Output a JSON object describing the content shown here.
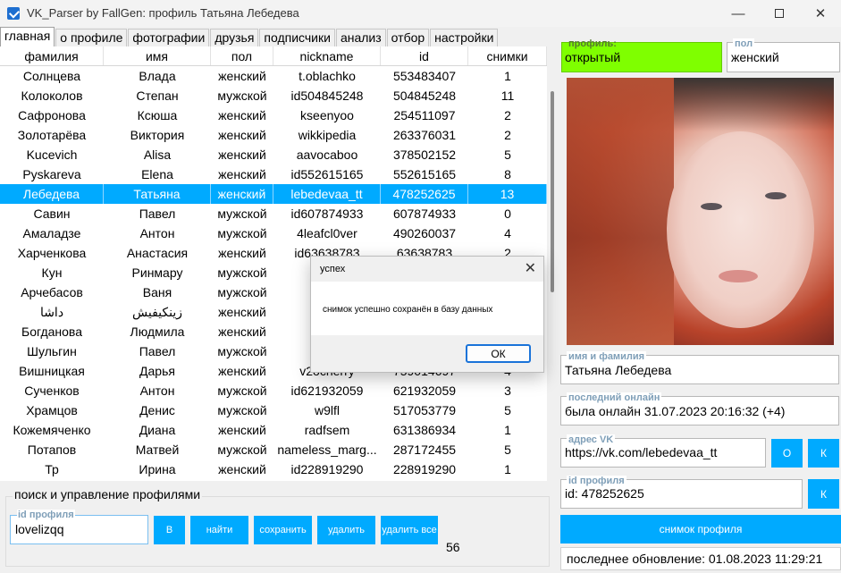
{
  "window": {
    "title": "VK_Parser by FallGen: профиль Татьяна Лебедева",
    "minimize": "—",
    "close": "✕"
  },
  "tabs": [
    "главная",
    "о профиле",
    "фотографии",
    "друзья",
    "подписчики",
    "анализ",
    "отбор",
    "настройки"
  ],
  "table": {
    "headers": [
      "фамилия",
      "имя",
      "пол",
      "nickname",
      "id",
      "снимки"
    ],
    "rows": [
      [
        "Солнцева",
        "Влада",
        "женский",
        "t.oblachko",
        "553483407",
        "1"
      ],
      [
        "Колоколов",
        "Степан",
        "мужской",
        "id504845248",
        "504845248",
        "11"
      ],
      [
        "Сафронова",
        "Ксюша",
        "женский",
        "kseenyoo",
        "254511097",
        "2"
      ],
      [
        "Золотарёва",
        "Виктория",
        "женский",
        "wikkipedia",
        "263376031",
        "2"
      ],
      [
        "Kucevich",
        "Alisa",
        "женский",
        "aavocaboo",
        "378502152",
        "5"
      ],
      [
        "Pyskareva",
        "Elena",
        "женский",
        "id552615165",
        "552615165",
        "8"
      ],
      [
        "Лебедева",
        "Татьяна",
        "женский",
        "lebedevaa_tt",
        "478252625",
        "13"
      ],
      [
        "Савин",
        "Павел",
        "мужской",
        "id607874933",
        "607874933",
        "0"
      ],
      [
        "Амаладзе",
        "Антон",
        "мужской",
        "4leafcl0ver",
        "490260037",
        "4"
      ],
      [
        "Харченкова",
        "Анастасия",
        "женский",
        "id63638783",
        "63638783",
        "2"
      ],
      [
        "Кун",
        "Ринмару",
        "мужской",
        "id70",
        "",
        ""
      ],
      [
        "Арчебасов",
        "Ваня",
        "мужской",
        "f",
        "",
        ""
      ],
      [
        "داشا",
        "زینکیفیش",
        "женский",
        "zir",
        "",
        ""
      ],
      [
        "Богданова",
        "Людмила",
        "женский",
        "p",
        "",
        ""
      ],
      [
        "Шульгин",
        "Павел",
        "мужской",
        "id55",
        "",
        ""
      ],
      [
        "Вишницкая",
        "Дарья",
        "женский",
        "v2ocherry",
        "759014697",
        "4"
      ],
      [
        "Сученков",
        "Антон",
        "мужской",
        "id621932059",
        "621932059",
        "3"
      ],
      [
        "Храмцов",
        "Денис",
        "мужской",
        "w9lfl",
        "517053779",
        "5"
      ],
      [
        "Кожемяченко",
        "Диана",
        "женский",
        "radfsem",
        "631386934",
        "1"
      ],
      [
        "Потапов",
        "Матвей",
        "мужской",
        "nameless_marg...",
        "287172455",
        "5"
      ],
      [
        "Тр",
        "Ирина",
        "женский",
        "id228919290",
        "228919290",
        "1"
      ]
    ],
    "selected_index": 6
  },
  "search": {
    "group_title": "поиск и управление профилями",
    "id_label": "id профиля",
    "id_value": "lovelizqq",
    "btn_b": "В",
    "btn_find": "найти",
    "btn_save": "сохранить",
    "btn_delete": "удалить",
    "btn_delete_all": "удалить все",
    "count": "56"
  },
  "profile": {
    "status_label": "профиль:",
    "status_value": "открытый",
    "gender_label": "пол",
    "gender_value": "женский",
    "name_label": "имя и фамилия",
    "name_value": "Татьяна Лебедева",
    "online_label": "последний онлайн",
    "online_value": "была онлайн 31.07.2023 20:16:32 (+4)",
    "url_label": "адрес VK",
    "url_value": "https://vk.com/lebedevaa_tt",
    "btn_o": "О",
    "btn_k1": "К",
    "id_label": "id профиля",
    "id_value": "id: 478252625",
    "btn_k2": "К",
    "snapshot_btn": "снимок профиля",
    "last_update": "последнее обновление: 01.08.2023 11:29:21"
  },
  "dialog": {
    "title": "успех",
    "message": "снимок успешно сохранён в базу данных",
    "ok": "ОК",
    "close": "✕"
  },
  "colors": {
    "accent": "#00aaff",
    "status_green": "#7fff00",
    "selection": "#00aaff"
  }
}
